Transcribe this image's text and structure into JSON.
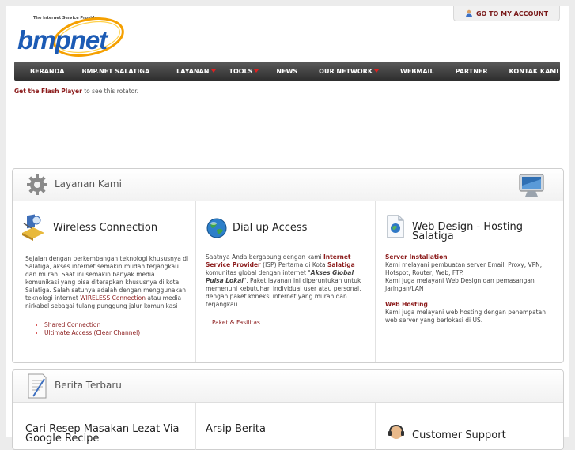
{
  "header": {
    "logo_text": "bmpnet",
    "logo_tagline": "The Internet Service Provider",
    "account_label": "GO TO MY ACCOUNT"
  },
  "nav": [
    {
      "label": "BERANDA",
      "dropdown": false
    },
    {
      "label": "BMP.NET SALATIGA",
      "dropdown": false
    },
    {
      "label": "LAYANAN",
      "dropdown": true
    },
    {
      "label": "TOOLS",
      "dropdown": true
    },
    {
      "label": "NEWS",
      "dropdown": false
    },
    {
      "label": "OUR NETWORK",
      "dropdown": true
    },
    {
      "label": "WEBMAIL",
      "dropdown": false
    },
    {
      "label": "PARTNER",
      "dropdown": false
    },
    {
      "label": "KONTAK KAMI",
      "dropdown": false
    }
  ],
  "flash": {
    "link": "Get the Flash Player",
    "text": " to see this rotator."
  },
  "layanan": {
    "title": "Layanan Kami",
    "wireless": {
      "title": "Wireless Connection",
      "body_1": "Sejalan dengan perkembangan teknologi khususnya di Salatiga, akses internet semakin mudah terjangkau dan murah. Saat ini semakin banyak media komunikasi yang bisa diterapkan khususnya di kota Salatiga. Salah satunya adalah dengan menggunakan teknologi internet ",
      "body_link": "WIRELESS Connection",
      "body_2": " atau media nirkabel sebagai tulang punggung jalur komunikasi",
      "links": [
        "Shared Connection",
        "Ultimate Access (Clear Channel)"
      ]
    },
    "dialup": {
      "title": "Dial up Access",
      "p1": "Saatnya Anda bergabung dengan kami ",
      "isp": "Internet Service Provider",
      "p2": " (ISP) Pertama di Kota ",
      "city": "Salatiga",
      "p3": " komunitas global dengan internet \"",
      "quote": "Akses Global Pulsa Lokal",
      "p4": "\". Paket layanan ini diperuntukan untuk memenuhi kebutuhan individual user atau personal, dengan paket koneksi internet yang murah dan terjangkau.",
      "link": "Paket & Fasilitas"
    },
    "webdesign": {
      "title": "Web Design - Hosting Salatiga",
      "h1": "Server Installation",
      "b1": "Kami melayani pembuatan server Email, Proxy, VPN, Hotspot, Router, Web, FTP.",
      "b1b": "Kami juga melayani Web Design dan pemasangan Jaringan/LAN",
      "h2": "Web Hosting",
      "b2": "Kami juga melayani web hosting dengan penempatan web server yang berlokasi di US."
    }
  },
  "berita": {
    "title": "Berita Terbaru",
    "col1": "Cari Resep Masakan Lezat Via Google Recipe",
    "col2": "Arsip Berita",
    "col3": "Customer Support"
  }
}
